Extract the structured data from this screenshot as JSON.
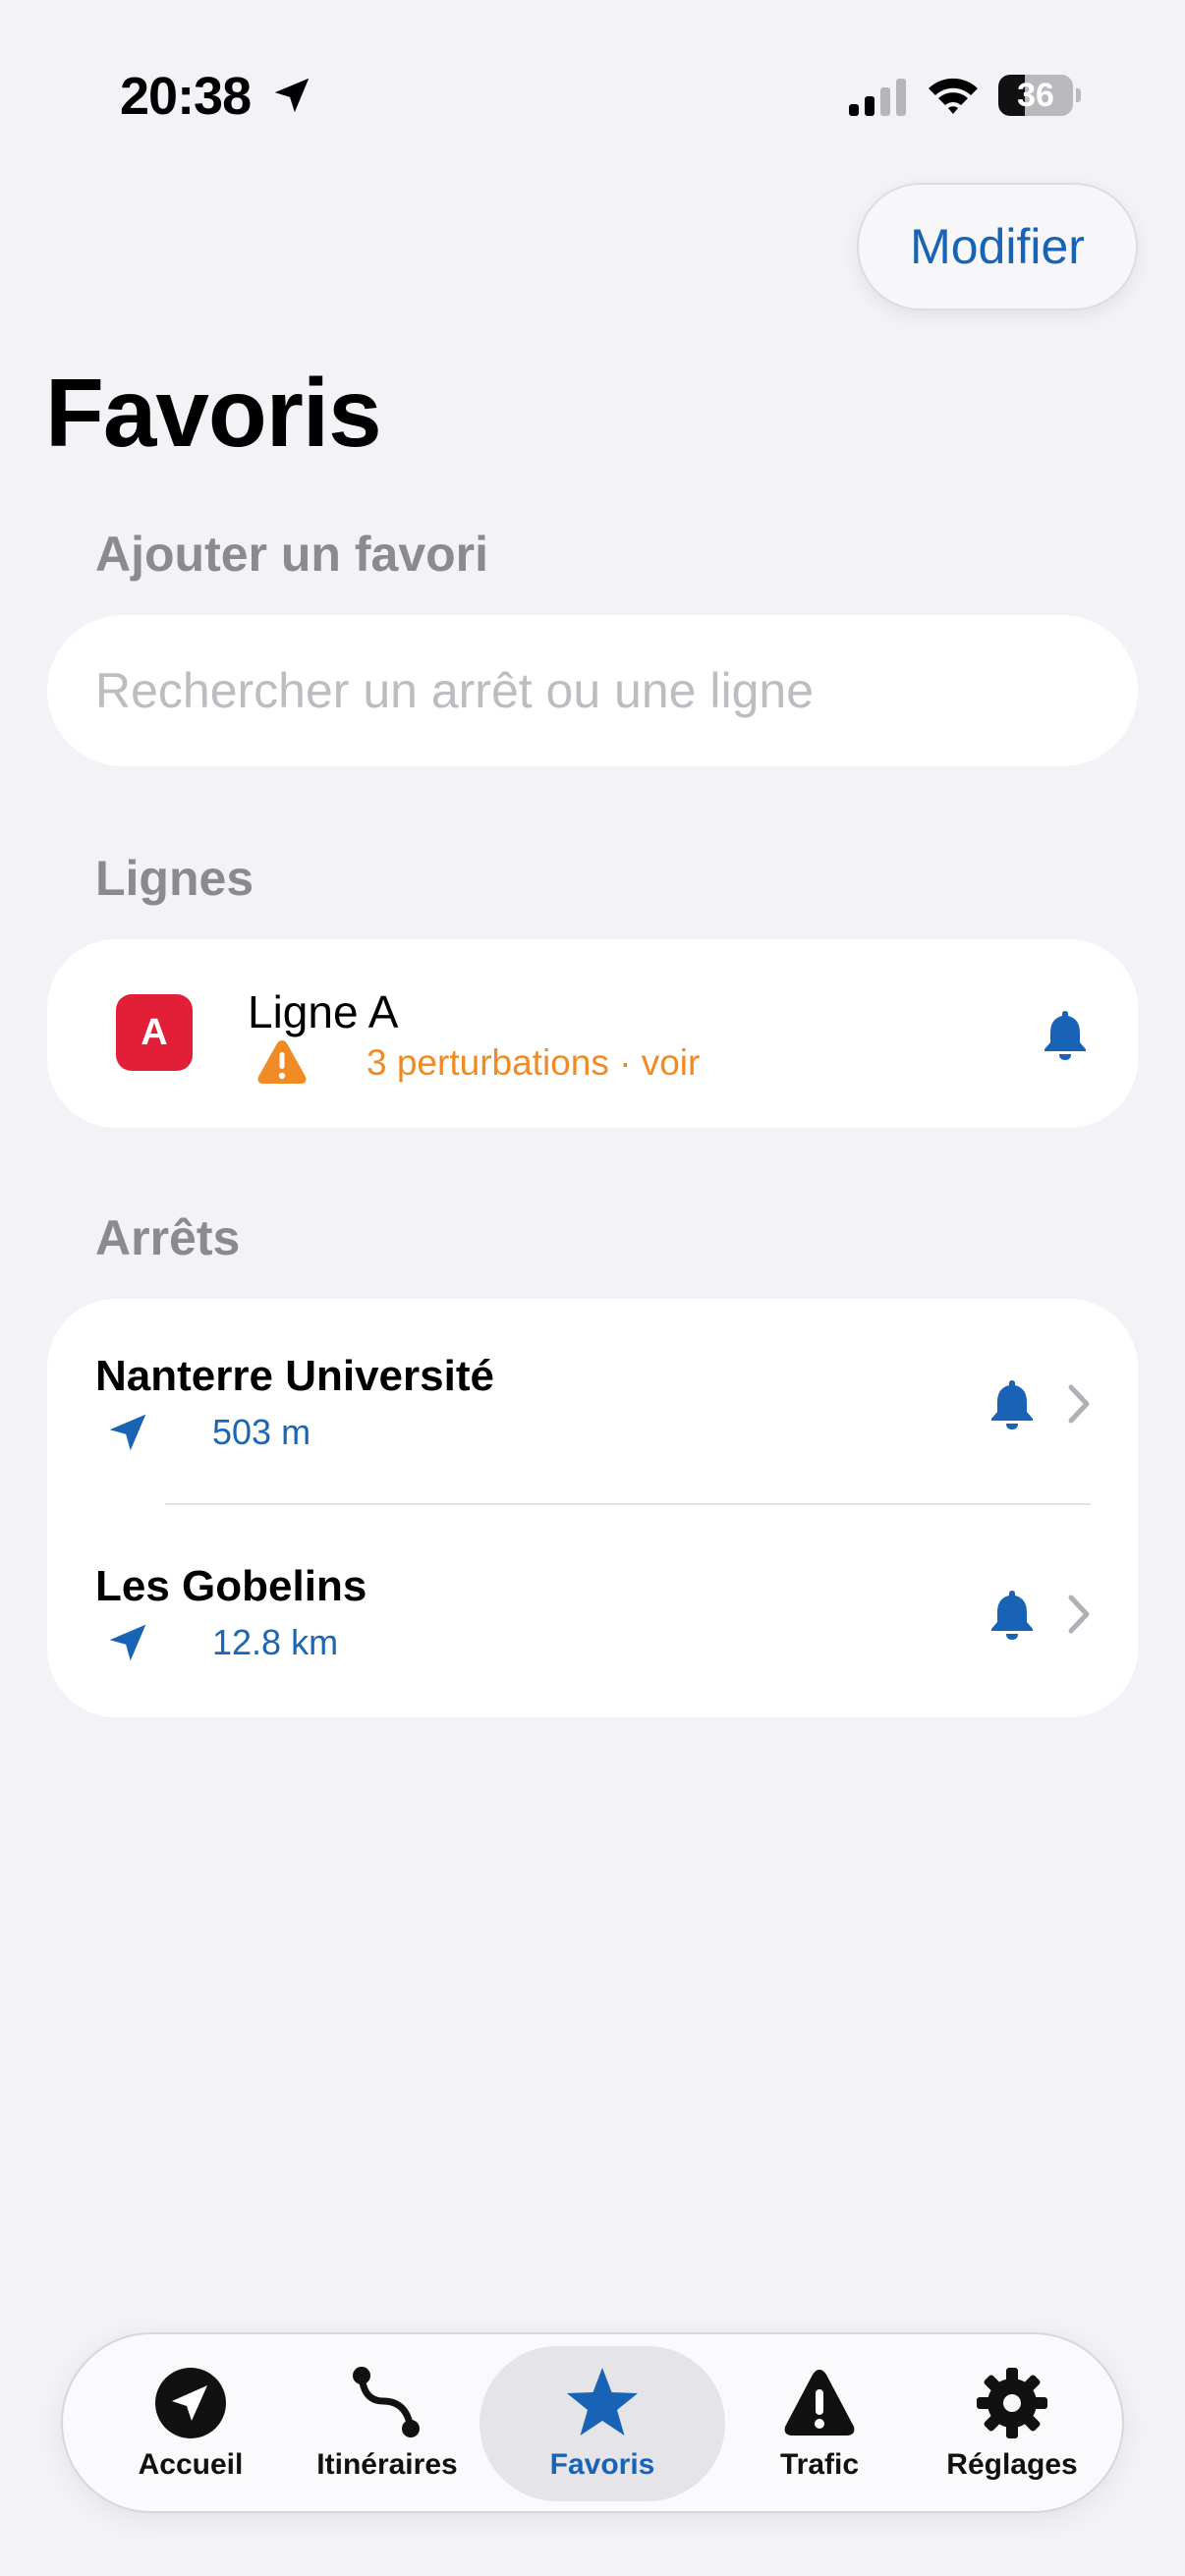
{
  "status_bar": {
    "time": "20:38",
    "battery": "36",
    "battery_level": 0.36,
    "icons": [
      "location-arrow-icon",
      "cellular-signal-icon",
      "wifi-icon",
      "battery-icon"
    ]
  },
  "header": {
    "edit_label": "Modifier",
    "title": "Favoris"
  },
  "add_section": {
    "header": "Ajouter un favori",
    "search_placeholder": "Rechercher un arrêt ou une ligne"
  },
  "lines_section": {
    "header": "Lignes",
    "items": [
      {
        "badge": "A",
        "badge_color": "#e21f36",
        "name": "Ligne A",
        "status": "3 perturbations · voir",
        "status_color": "#f08a24",
        "icons": [
          "warning-icon",
          "bell-icon"
        ]
      }
    ]
  },
  "stops_section": {
    "header": "Arrêts",
    "items": [
      {
        "name": "Nanterre Université",
        "distance": "503 m",
        "icons": [
          "location-arrow-icon",
          "bell-icon",
          "chevron-right-icon"
        ]
      },
      {
        "name": "Les Gobelins",
        "distance": "12.8 km",
        "icons": [
          "location-arrow-icon",
          "bell-icon",
          "chevron-right-icon"
        ]
      }
    ]
  },
  "tab_bar": {
    "active": "Favoris",
    "tabs": [
      {
        "label": "Accueil",
        "icon": "navigation-circle-icon"
      },
      {
        "label": "Itinéraires",
        "icon": "route-icon"
      },
      {
        "label": "Favoris",
        "icon": "star-icon"
      },
      {
        "label": "Trafic",
        "icon": "warning-triangle-icon"
      },
      {
        "label": "Réglages",
        "icon": "gear-icon"
      }
    ]
  },
  "colors": {
    "accent": "#1863b5",
    "background": "#f2f2f7",
    "card": "#ffffff",
    "secondary_text": "#8a8a8f",
    "warning": "#f08a24"
  }
}
